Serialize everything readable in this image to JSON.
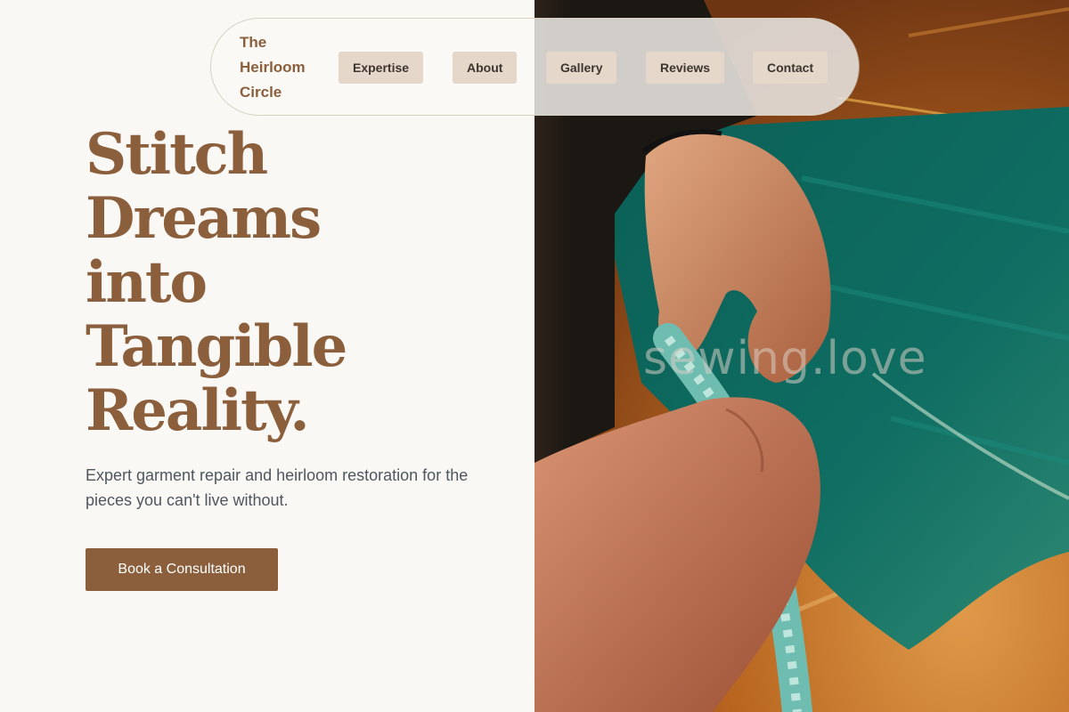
{
  "nav": {
    "brand": "The Heirloom Circle",
    "links": [
      "Expertise",
      "About",
      "Gallery",
      "Reviews",
      "Contact"
    ]
  },
  "hero": {
    "headline_lines": [
      "Stitch",
      "Dreams",
      "into",
      "Tangible",
      "Reality."
    ],
    "subtext": "Expert garment repair and heirloom restoration for the pieces you can't live without.",
    "cta_label": "Book a Consultation"
  },
  "photo": {
    "watermark": "sewing.love",
    "subject": "hands-tying-rope-on-green-net",
    "colors": {
      "floor": "#b8651f",
      "net": "#0f6d62",
      "rope": "#6fbdb1",
      "skin": "#c98a67"
    }
  },
  "theme": {
    "background": "#faf8f5",
    "accent": "#8b5e3c",
    "nav_button_bg": "#e6d7cb",
    "body_text": "#4f5660"
  }
}
